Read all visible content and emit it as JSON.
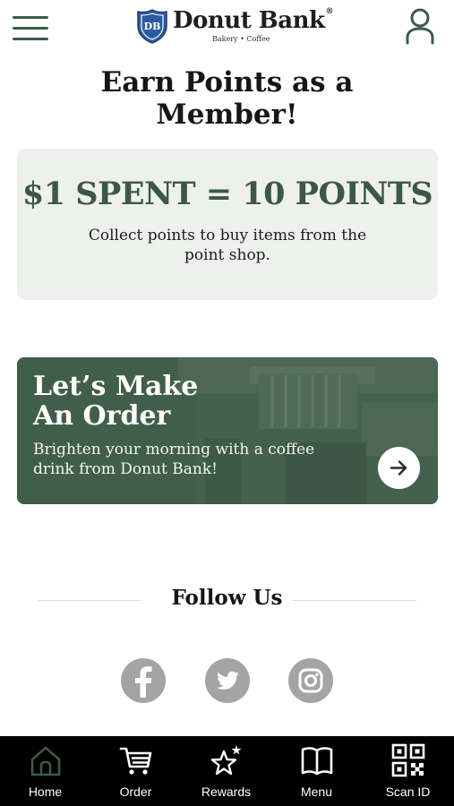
{
  "header": {
    "brand_name": "Donut Bank",
    "brand_reg": "®",
    "brand_tagline": "Bakery  •  Coffee",
    "badge_text": "DB",
    "menu_icon": "hamburger-icon",
    "account_icon": "user-icon"
  },
  "page": {
    "title_line1": "Earn Points as a",
    "title_line2": "Member!"
  },
  "points_card": {
    "headline": "$1 SPENT = 10 POINTS",
    "description": "Collect points to buy items from the point shop."
  },
  "order_card": {
    "title_line1": "Let’s Make",
    "title_line2": "An Order",
    "description": "Brighten your morning with a coffee drink from Donut Bank!",
    "action_icon": "arrow-right-icon"
  },
  "follow": {
    "title": "Follow Us",
    "icons": [
      "facebook-icon",
      "twitter-icon",
      "instagram-icon"
    ]
  },
  "nav": {
    "items": [
      {
        "label": "Home",
        "icon": "home-icon"
      },
      {
        "label": "Order",
        "icon": "cart-icon"
      },
      {
        "label": "Rewards",
        "icon": "rewards-star-icon"
      },
      {
        "label": "Menu",
        "icon": "book-icon"
      },
      {
        "label": "Scan ID",
        "icon": "qr-code-icon"
      }
    ]
  },
  "colors": {
    "brand_green": "#3b5847",
    "card_bg": "#eef0ee",
    "nav_bg": "#000000",
    "social_gray": "#a4a4a4",
    "logo_blue": "#2c5aa0"
  }
}
